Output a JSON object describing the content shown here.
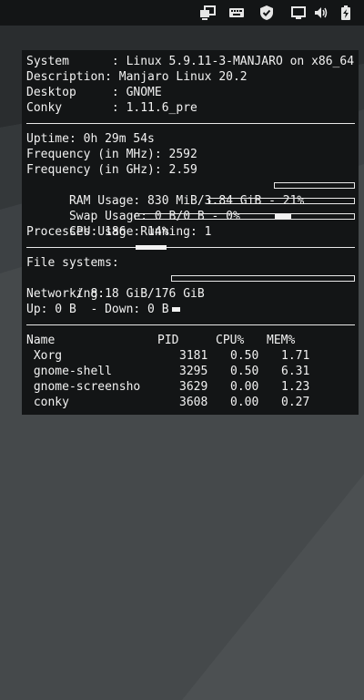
{
  "system": {
    "rows": [
      {
        "label": "System     ",
        "value": "Linux 5.9.11-3-MANJARO on x86_64"
      },
      {
        "label": "Description",
        "value": "Manjaro Linux 20.2"
      },
      {
        "label": "Desktop    ",
        "value": "GNOME"
      },
      {
        "label": "Conky      ",
        "value": "1.11.6_pre"
      }
    ]
  },
  "stats": {
    "uptime": "Uptime: 0h 29m 54s",
    "freq_mhz": "Frequency (in MHz): 2592",
    "freq_ghz": "Frequency (in GHz): 2.59",
    "ram": "RAM Usage: 830 MiB/3.84 GiB - 21%",
    "ram_fraction": 0.21,
    "swap": "Swap Usage: 0 B/0 B - 0%",
    "swap_fraction": 0.0,
    "cpu": "CPU Usage: 14%",
    "cpu_fraction": 0.14,
    "processes": "Processes: 186  Running: 1"
  },
  "filesystems": {
    "header": "File systems:",
    "root": " / 8.18 GiB/176 GiB",
    "root_fraction": 0.046
  },
  "network": {
    "header": "Networking:",
    "line": "Up: 0 B  - Down: 0 B"
  },
  "processes": {
    "headers": {
      "name": "Name",
      "pid": "PID",
      "cpu": "CPU%",
      "mem": "MEM%"
    },
    "rows": [
      {
        "name": " Xorg",
        "pid": "3181",
        "cpu": "0.50",
        "mem": "1.71"
      },
      {
        "name": " gnome-shell",
        "pid": "3295",
        "cpu": "0.50",
        "mem": "6.31"
      },
      {
        "name": " gnome-screensho",
        "pid": "3629",
        "cpu": "0.00",
        "mem": "1.23"
      },
      {
        "name": " conky",
        "pid": "3608",
        "cpu": "0.00",
        "mem": "0.27"
      }
    ]
  },
  "tray": {
    "icons": [
      "display-switch-icon",
      "keyboard-icon",
      "shield-icon",
      "screen-icon",
      "volume-icon",
      "battery-icon"
    ]
  },
  "colors": {
    "panel_bg": "#131516",
    "text": "#f2f2f2",
    "desktop_bg": "#3d4144"
  }
}
